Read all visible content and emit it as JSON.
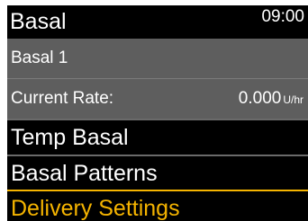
{
  "header": {
    "title": "Basal",
    "time": "09:00"
  },
  "status": {
    "pattern_name": "Basal 1",
    "current_rate_label": "Current Rate:",
    "current_rate_value": "0.000",
    "current_rate_unit": "U/hr"
  },
  "menu": {
    "items": [
      {
        "label": "Temp Basal"
      },
      {
        "label": "Basal Patterns"
      },
      {
        "label": "Delivery Settings",
        "selected": true
      }
    ]
  },
  "colors": {
    "background": "#000000",
    "panel": "#5e5e5e",
    "text": "#ffffff",
    "selection": "#f5b400"
  }
}
